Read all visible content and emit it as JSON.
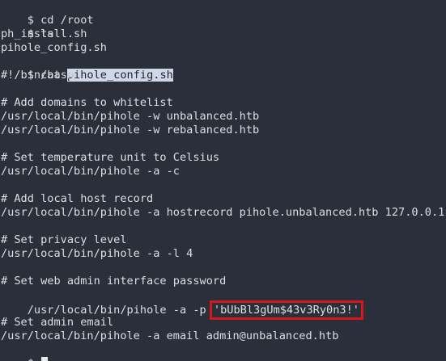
{
  "terminal": {
    "prompt": "$",
    "cmd1": "cd /root",
    "cmd2": "ls",
    "ls_out1": "ph_install.sh",
    "ls_out2": "pihole_config.sh",
    "cmd3_prefix": "cat ",
    "cmd3_selected": "pihole_config.sh",
    "shebang": "#!/bin/bash",
    "c1": "# Add domains to whitelist",
    "l1": "/usr/local/bin/pihole -w unbalanced.htb",
    "l2": "/usr/local/bin/pihole -w rebalanced.htb",
    "c2": "# Set temperature unit to Celsius",
    "l3": "/usr/local/bin/pihole -a -c",
    "c3": "# Add local host record",
    "l4": "/usr/local/bin/pihole -a hostrecord pihole.unbalanced.htb 127.0.0.1",
    "c4": "# Set privacy level",
    "l5": "/usr/local/bin/pihole -a -l 4",
    "c5": "# Set web admin interface password",
    "l6_prefix": "/usr/local/bin/pihole -a -p ",
    "password": "'bUbBl3gUm$43v3Ry0n3!'",
    "c6": "# Set admin email",
    "l7": "/usr/local/bin/pihole -a email admin@unbalanced.htb"
  }
}
